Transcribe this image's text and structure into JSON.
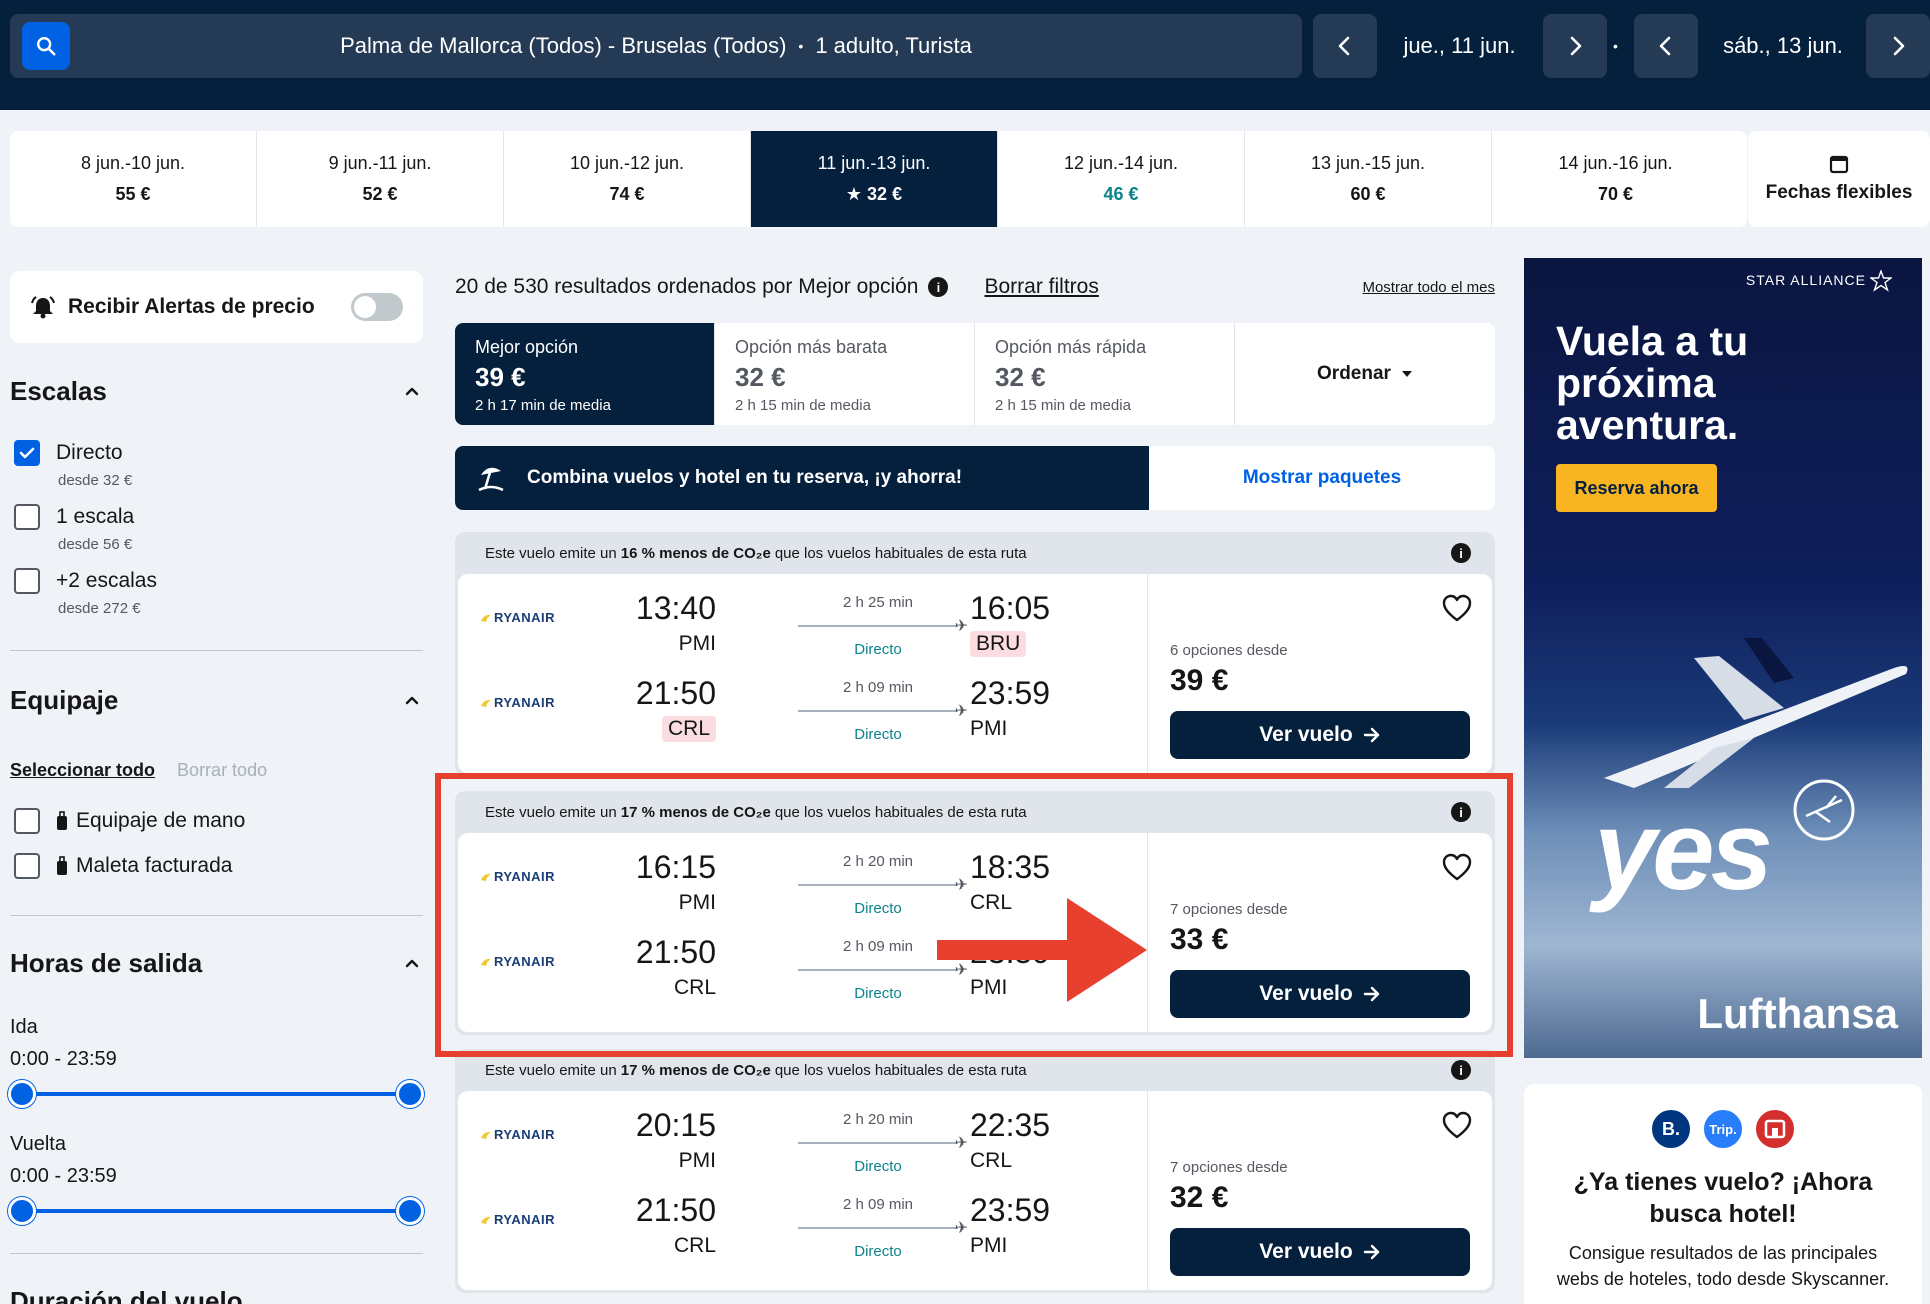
{
  "header": {
    "route": "Palma de Mallorca (Todos) - Bruselas (Todos)",
    "passengers": "1 adulto, Turista",
    "depart_date": "jue., 11 jun.",
    "return_date": "sáb., 13 jun."
  },
  "date_strip": [
    {
      "range": "8 jun.-10 jun.",
      "price": "55 €"
    },
    {
      "range": "9 jun.-11 jun.",
      "price": "52 €"
    },
    {
      "range": "10 jun.-12 jun.",
      "price": "74 €"
    },
    {
      "range": "11 jun.-13 jun.",
      "price": "★ 32 €",
      "active": true
    },
    {
      "range": "12 jun.-14 jun.",
      "price": "46 €",
      "cheap": true
    },
    {
      "range": "13 jun.-15 jun.",
      "price": "60 €"
    },
    {
      "range": "14 jun.-16 jun.",
      "price": "70 €"
    }
  ],
  "flex_dates_label": "Fechas flexibles",
  "sidebar": {
    "alert_label": "Recibir Alertas de precio",
    "stops": {
      "title": "Escalas",
      "options": [
        {
          "label": "Directo",
          "sub": "desde 32 €",
          "checked": true
        },
        {
          "label": "1 escala",
          "sub": "desde 56 €",
          "checked": false
        },
        {
          "label": "+2 escalas",
          "sub": "desde 272 €",
          "checked": false
        }
      ]
    },
    "baggage": {
      "title": "Equipaje",
      "select_all": "Seleccionar todo",
      "clear_all": "Borrar todo",
      "options": [
        "Equipaje de mano",
        "Maleta facturada"
      ]
    },
    "times": {
      "title": "Horas de salida",
      "outbound_label": "Ida",
      "outbound_range": "0:00 - 23:59",
      "return_label": "Vuelta",
      "return_range": "0:00 - 23:59"
    },
    "duration_title": "Duración del vuelo"
  },
  "results": {
    "summary": "20 de 530 resultados ordenados por Mejor opción",
    "clear_filters": "Borrar filtros",
    "show_month": "Mostrar todo el mes",
    "sort_tabs": [
      {
        "title": "Mejor opción",
        "price": "39 €",
        "duration": "2 h 17 min de media",
        "active": true
      },
      {
        "title": "Opción más barata",
        "price": "32 €",
        "duration": "2 h 15 min de media"
      },
      {
        "title": "Opción más rápida",
        "price": "32 €",
        "duration": "2 h 15 min de media"
      }
    ],
    "sort_label": "Ordenar",
    "promo_text": "Combina vuelos y hotel en tu reserva, ¡y ahorra!",
    "promo_button": "Mostrar paquetes",
    "eco_prefix": "Este vuelo emite un",
    "eco_suffix": "que los vuelos habituales de esta ruta",
    "options_from_label": "opciones desde",
    "view_button": "Ver vuelo",
    "tickets": [
      {
        "eco_pct": "16 % menos de CO₂e",
        "options": "6 opciones desde",
        "price": "39 €",
        "legs": [
          {
            "airline": "RYANAIR",
            "dep_time": "13:40",
            "dep_code": "PMI",
            "duration": "2 h 25 min",
            "stops": "Directo",
            "arr_time": "16:05",
            "arr_code": "BRU",
            "arr_hl": true
          },
          {
            "airline": "RYANAIR",
            "dep_time": "21:50",
            "dep_code": "CRL",
            "duration": "2 h 09 min",
            "stops": "Directo",
            "arr_time": "23:59",
            "arr_code": "PMI",
            "dep_hl": true
          }
        ]
      },
      {
        "eco_pct": "17 % menos de CO₂e",
        "options": "7 opciones desde",
        "price": "33 €",
        "legs": [
          {
            "airline": "RYANAIR",
            "dep_time": "16:15",
            "dep_code": "PMI",
            "duration": "2 h 20 min",
            "stops": "Directo",
            "arr_time": "18:35",
            "arr_code": "CRL"
          },
          {
            "airline": "RYANAIR",
            "dep_time": "21:50",
            "dep_code": "CRL",
            "duration": "2 h 09 min",
            "stops": "Directo",
            "arr_time": "23:59",
            "arr_code": "PMI"
          }
        ]
      },
      {
        "eco_pct": "17 % menos de CO₂e",
        "options": "7 opciones desde",
        "price": "32 €",
        "legs": [
          {
            "airline": "RYANAIR",
            "dep_time": "20:15",
            "dep_code": "PMI",
            "duration": "2 h 20 min",
            "stops": "Directo",
            "arr_time": "22:35",
            "arr_code": "CRL"
          },
          {
            "airline": "RYANAIR",
            "dep_time": "21:50",
            "dep_code": "CRL",
            "duration": "2 h 09 min",
            "stops": "Directo",
            "arr_time": "23:59",
            "arr_code": "PMI"
          }
        ]
      }
    ]
  },
  "ad": {
    "alliance": "STAR ALLIANCE",
    "headline": "Vuela a tu próxima aventura.",
    "cta": "Reserva ahora",
    "tagline": "yes",
    "brand": "Lufthansa"
  },
  "hotel_card": {
    "title": "¿Ya tienes vuelo? ¡Ahora busca hotel!",
    "body": "Consigue resultados de las principales webs de hoteles, todo desde Skyscanner.",
    "logos": [
      "B.",
      "Trip.",
      "H"
    ]
  },
  "colors": {
    "navy": "#05203c",
    "blue": "#0062e3",
    "teal": "#0c838a",
    "highlight_red": "#e8402f"
  }
}
